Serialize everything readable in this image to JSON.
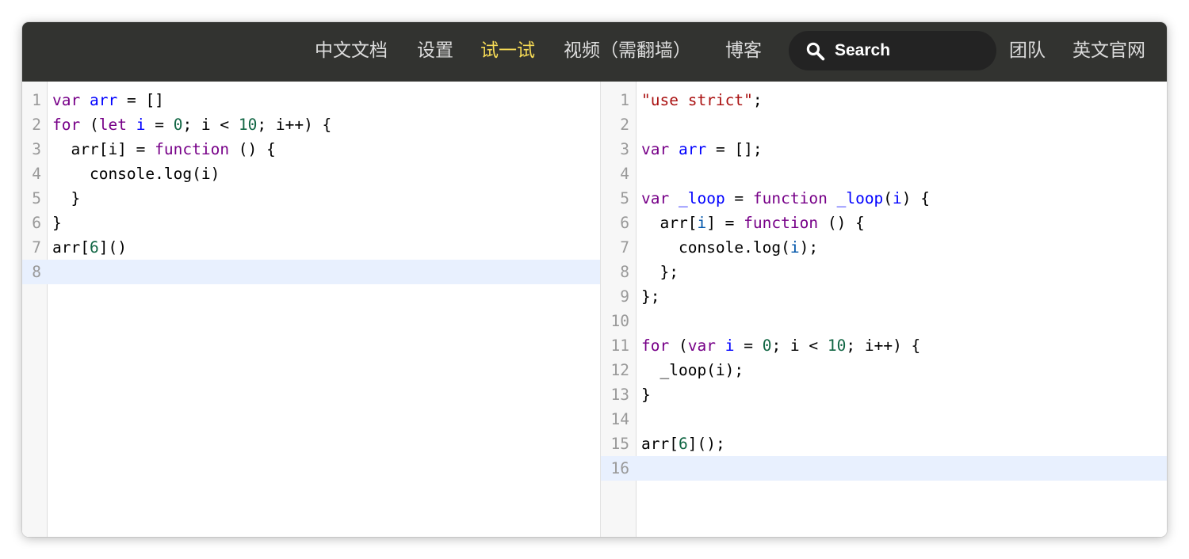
{
  "nav": {
    "items": [
      {
        "label": "中文文档",
        "active": false
      },
      {
        "label": "设置",
        "active": false
      },
      {
        "label": "试一试",
        "active": true
      },
      {
        "label": "视频（需翻墙）",
        "active": false
      },
      {
        "label": "博客",
        "active": false
      }
    ],
    "search": {
      "placeholder": "Search",
      "icon": "search-icon"
    },
    "right_items": [
      {
        "label": "团队"
      },
      {
        "label": "英文官网"
      }
    ],
    "colors": {
      "bar": "#323330",
      "active": "#f5da55",
      "text": "#dcdcdc"
    }
  },
  "input_editor": {
    "current_line": 8,
    "lines": [
      {
        "n": "1",
        "tokens": [
          {
            "t": "var",
            "c": "kw"
          },
          {
            "t": " "
          },
          {
            "t": "arr",
            "c": "def"
          },
          {
            "t": " = []"
          }
        ]
      },
      {
        "n": "2",
        "tokens": [
          {
            "t": "for",
            "c": "kw"
          },
          {
            "t": " ("
          },
          {
            "t": "let",
            "c": "kw"
          },
          {
            "t": " "
          },
          {
            "t": "i",
            "c": "def"
          },
          {
            "t": " = "
          },
          {
            "t": "0",
            "c": "num"
          },
          {
            "t": "; i < "
          },
          {
            "t": "10",
            "c": "num"
          },
          {
            "t": "; i++) {"
          }
        ]
      },
      {
        "n": "3",
        "tokens": [
          {
            "t": "  arr[i] = "
          },
          {
            "t": "function",
            "c": "kw"
          },
          {
            "t": " () {"
          }
        ]
      },
      {
        "n": "4",
        "tokens": [
          {
            "t": "    console.log(i)"
          }
        ]
      },
      {
        "n": "5",
        "tokens": [
          {
            "t": "  }"
          }
        ]
      },
      {
        "n": "6",
        "tokens": [
          {
            "t": "}"
          }
        ]
      },
      {
        "n": "7",
        "tokens": [
          {
            "t": "arr["
          },
          {
            "t": "6",
            "c": "num"
          },
          {
            "t": "]()"
          }
        ]
      },
      {
        "n": "8",
        "tokens": []
      }
    ]
  },
  "output_editor": {
    "current_line": 16,
    "lines": [
      {
        "n": "1",
        "tokens": [
          {
            "t": "\"use strict\"",
            "c": "str"
          },
          {
            "t": ";"
          }
        ]
      },
      {
        "n": "2",
        "tokens": []
      },
      {
        "n": "3",
        "tokens": [
          {
            "t": "var",
            "c": "kw"
          },
          {
            "t": " "
          },
          {
            "t": "arr",
            "c": "def"
          },
          {
            "t": " = [];"
          }
        ]
      },
      {
        "n": "4",
        "tokens": []
      },
      {
        "n": "5",
        "tokens": [
          {
            "t": "var",
            "c": "kw"
          },
          {
            "t": " "
          },
          {
            "t": "_loop",
            "c": "def"
          },
          {
            "t": " = "
          },
          {
            "t": "function",
            "c": "kw"
          },
          {
            "t": " "
          },
          {
            "t": "_loop",
            "c": "def"
          },
          {
            "t": "("
          },
          {
            "t": "i",
            "c": "def"
          },
          {
            "t": ") {"
          }
        ]
      },
      {
        "n": "6",
        "tokens": [
          {
            "t": "  arr["
          },
          {
            "t": "i",
            "c": "v2"
          },
          {
            "t": "] = "
          },
          {
            "t": "function",
            "c": "kw"
          },
          {
            "t": " () {"
          }
        ]
      },
      {
        "n": "7",
        "tokens": [
          {
            "t": "    console.log("
          },
          {
            "t": "i",
            "c": "v2"
          },
          {
            "t": ");"
          }
        ]
      },
      {
        "n": "8",
        "tokens": [
          {
            "t": "  };"
          }
        ]
      },
      {
        "n": "9",
        "tokens": [
          {
            "t": "};"
          }
        ]
      },
      {
        "n": "10",
        "tokens": []
      },
      {
        "n": "11",
        "tokens": [
          {
            "t": "for",
            "c": "kw"
          },
          {
            "t": " ("
          },
          {
            "t": "var",
            "c": "kw"
          },
          {
            "t": " "
          },
          {
            "t": "i",
            "c": "def"
          },
          {
            "t": " = "
          },
          {
            "t": "0",
            "c": "num"
          },
          {
            "t": "; i < "
          },
          {
            "t": "10",
            "c": "num"
          },
          {
            "t": "; i++) {"
          }
        ]
      },
      {
        "n": "12",
        "tokens": [
          {
            "t": "  _loop(i);"
          }
        ]
      },
      {
        "n": "13",
        "tokens": [
          {
            "t": "}"
          }
        ]
      },
      {
        "n": "14",
        "tokens": []
      },
      {
        "n": "15",
        "tokens": [
          {
            "t": "arr["
          },
          {
            "t": "6",
            "c": "num"
          },
          {
            "t": "]();"
          }
        ]
      },
      {
        "n": "16",
        "tokens": []
      }
    ]
  }
}
